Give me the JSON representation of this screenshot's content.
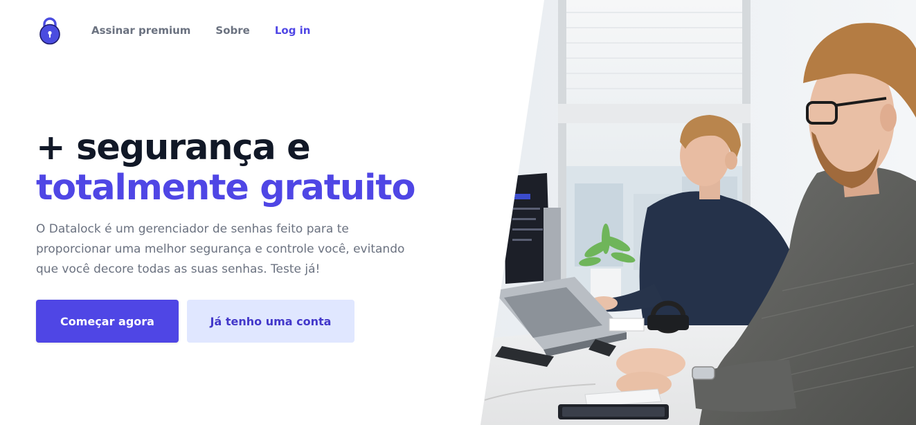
{
  "brand": {
    "logo_icon": "padlock-icon",
    "primary_color": "#4f46e5",
    "primary_light": "#e0e7ff"
  },
  "nav": {
    "items": [
      {
        "label": "Assinar premium"
      },
      {
        "label": "Sobre"
      },
      {
        "label": "Log in"
      }
    ]
  },
  "hero": {
    "headline_line1": "+ segurança e",
    "headline_line2": "totalmente gratuito",
    "description": "O Datalock é um gerenciador de senhas feito para te proporcionar uma melhor segurança e controle você, evitando que você decore todas as suas senhas. Teste já!",
    "primary_cta": "Começar agora",
    "secondary_cta": "Já tenho uma conta",
    "image": "office-photo-two-men-at-laptops"
  }
}
